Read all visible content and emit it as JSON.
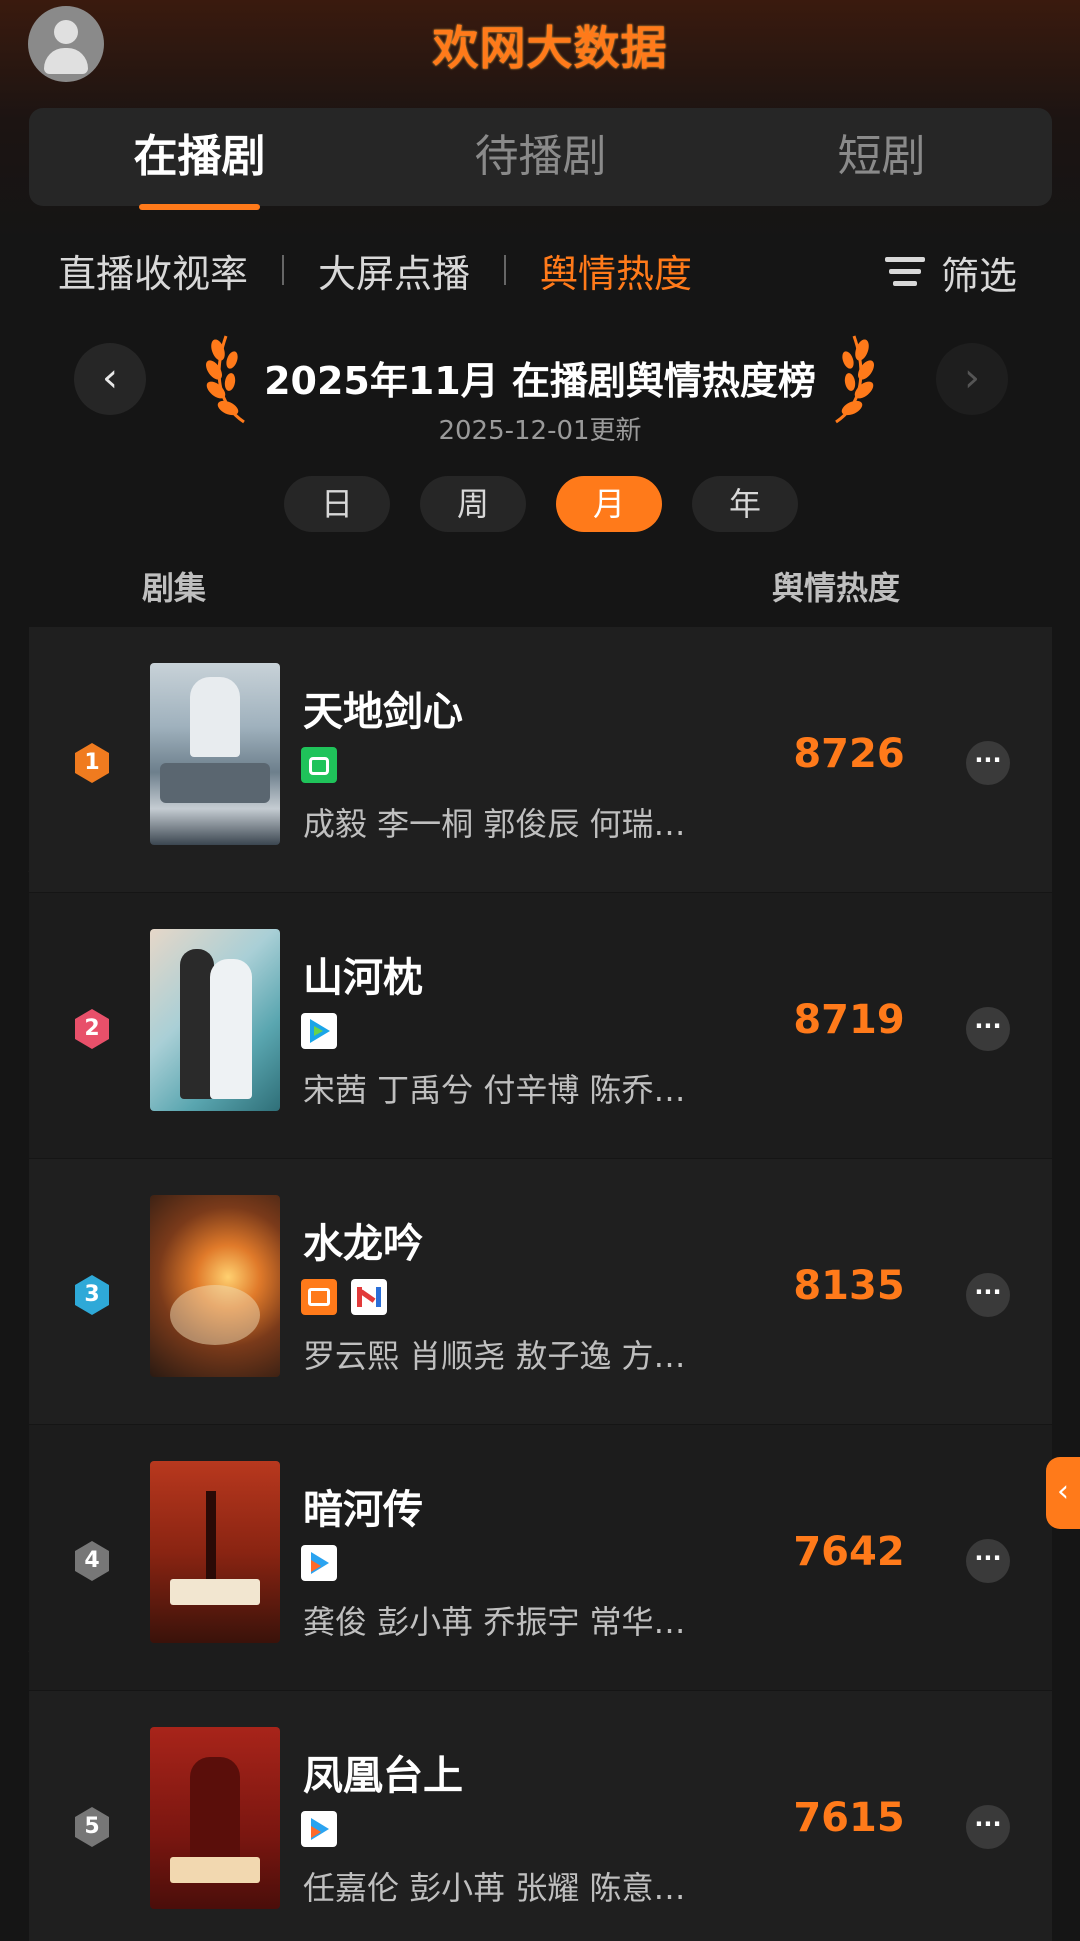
{
  "header": {
    "logo_text": "欢网大数据"
  },
  "main_tabs": [
    {
      "label": "在播剧",
      "active": true
    },
    {
      "label": "待播剧",
      "active": false
    },
    {
      "label": "短剧",
      "active": false
    }
  ],
  "sub_tabs": [
    {
      "label": "直播收视率",
      "active": false
    },
    {
      "label": "大屏点播",
      "active": false
    },
    {
      "label": "舆情热度",
      "active": true
    }
  ],
  "filter_label": "筛选",
  "ranking": {
    "title": "2025年11月 在播剧舆情热度榜",
    "updated": "2025-12-01更新",
    "prev_label": "‹",
    "next_label": "›"
  },
  "periods": [
    {
      "label": "日",
      "active": false
    },
    {
      "label": "周",
      "active": false
    },
    {
      "label": "月",
      "active": true
    },
    {
      "label": "年",
      "active": false
    }
  ],
  "columns": {
    "left": "剧集",
    "right": "舆情热度"
  },
  "rows": [
    {
      "rank": "1",
      "rank_color": "#f07b1f",
      "title": "天地剑心",
      "cast": "成毅 李一桐 郭俊辰 何瑞…",
      "score": "8726",
      "platforms": [
        "iqiyi-icon"
      ]
    },
    {
      "rank": "2",
      "rank_color": "#e8506a",
      "title": "山河枕",
      "cast": "宋茜 丁禹兮 付辛博 陈乔…",
      "score": "8719",
      "platforms": [
        "tencent-video-icon"
      ]
    },
    {
      "rank": "3",
      "rank_color": "#2ea9d8",
      "title": "水龙吟",
      "cast": "罗云熙 肖顺尧 敖子逸 方…",
      "score": "8135",
      "platforms": [
        "mango-tv-icon",
        "migu-icon"
      ]
    },
    {
      "rank": "4",
      "rank_color": "#777777",
      "title": "暗河传",
      "cast": "龚俊 彭小苒 乔振宇 常华…",
      "score": "7642",
      "platforms": [
        "youku-icon"
      ]
    },
    {
      "rank": "5",
      "rank_color": "#777777",
      "title": "凤凰台上",
      "cast": "任嘉伦 彭小苒 张耀 陈意…",
      "score": "7615",
      "platforms": [
        "youku-icon"
      ]
    }
  ],
  "more_label": "···",
  "side_tab_label": "‹",
  "colors": {
    "accent": "#ff7a1a",
    "background": "#151515",
    "row_bg": "#1f1f1f"
  }
}
